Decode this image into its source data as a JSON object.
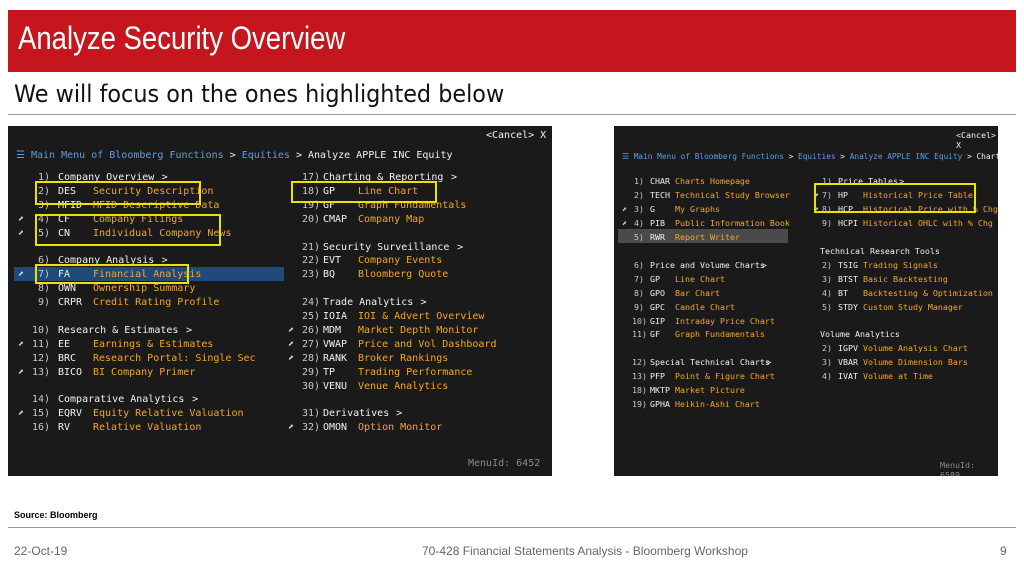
{
  "slide": {
    "title": "Analyze Security Overview",
    "subtitle": "We will focus on the ones highlighted below",
    "source": "Source: Bloomberg",
    "footer_date": "22-Oct-19",
    "footer_course": "70-428 Financial Statements Analysis - Bloomberg Workshop",
    "page_number": "9"
  },
  "colors": {
    "title_bar": "#c4161c",
    "terminal_bg": "#1a1a1a",
    "terminal_link": "#5a9fe6",
    "terminal_desc": "#f5a623",
    "highlight": "#f0e000"
  },
  "terminal1": {
    "cancel": "<Cancel> X",
    "breadcrumb": [
      {
        "text": "Main Menu of Bloomberg Functions",
        "kind": "link"
      },
      {
        "text": ">",
        "kind": "sep"
      },
      {
        "text": "Equities",
        "kind": "link"
      },
      {
        "text": ">",
        "kind": "sep"
      },
      {
        "text": "Analyze APPLE INC Equity",
        "kind": "current"
      }
    ],
    "menu_id": "MenuId: 6452",
    "left_column": [
      {
        "num": "1)",
        "header": "Company Overview"
      },
      {
        "num": "2)",
        "code": "DES",
        "desc": "Security Description"
      },
      {
        "num": "3)",
        "code": "MFID",
        "desc": "MFID Descriptive Data"
      },
      {
        "arrow": true,
        "num": "4)",
        "code": "CF",
        "desc": "Company Filings"
      },
      {
        "arrow": true,
        "num": "5)",
        "code": "CN",
        "desc": "Individual Company News"
      },
      {
        "blank": true
      },
      {
        "num": "6)",
        "header": "Company Analysis"
      },
      {
        "arrow": true,
        "num": "7)",
        "code": "FA",
        "desc": "Financial Analysis",
        "selected": true
      },
      {
        "num": "8)",
        "code": "OWN",
        "desc": "Ownership Summary"
      },
      {
        "num": "9)",
        "code": "CRPR",
        "desc": "Credit Rating Profile"
      },
      {
        "blank": true
      },
      {
        "num": "10)",
        "header": "Research & Estimates"
      },
      {
        "arrow": true,
        "num": "11)",
        "code": "EE",
        "desc": "Earnings & Estimates"
      },
      {
        "num": "12)",
        "code": "BRC",
        "desc": "Research Portal: Single Sec"
      },
      {
        "arrow": true,
        "num": "13)",
        "code": "BICO",
        "desc": "BI Company Primer"
      },
      {
        "blank": true
      },
      {
        "num": "14)",
        "header": "Comparative Analytics"
      },
      {
        "arrow": true,
        "num": "15)",
        "code": "EQRV",
        "desc": "Equity Relative Valuation"
      },
      {
        "num": "16)",
        "code": "RV",
        "desc": "Relative Valuation"
      }
    ],
    "right_column": [
      {
        "num": "17)",
        "header": "Charting & Reporting"
      },
      {
        "num": "18)",
        "code": "GP",
        "desc": "Line Chart"
      },
      {
        "num": "19)",
        "code": "GF",
        "desc": "Graph Fundamentals"
      },
      {
        "num": "20)",
        "code": "CMAP",
        "desc": "Company Map"
      },
      {
        "blank": true
      },
      {
        "num": "21)",
        "header": "Security Surveillance"
      },
      {
        "num": "22)",
        "code": "EVT",
        "desc": "Company Events"
      },
      {
        "num": "23)",
        "code": "BQ",
        "desc": "Bloomberg Quote"
      },
      {
        "blank": true
      },
      {
        "num": "24)",
        "header": "Trade Analytics"
      },
      {
        "num": "25)",
        "code": "IOIA",
        "desc": "IOI & Advert Overview"
      },
      {
        "arrow": true,
        "num": "26)",
        "code": "MDM",
        "desc": "Market Depth Monitor"
      },
      {
        "arrow": true,
        "num": "27)",
        "code": "VWAP",
        "desc": "Price and Vol Dashboard"
      },
      {
        "arrow": true,
        "num": "28)",
        "code": "RANK",
        "desc": "Broker Rankings"
      },
      {
        "num": "29)",
        "code": "TP",
        "desc": "Trading Performance"
      },
      {
        "num": "30)",
        "code": "VENU",
        "desc": "Venue Analytics"
      },
      {
        "blank": true
      },
      {
        "num": "31)",
        "header": "Derivatives"
      },
      {
        "arrow": true,
        "num": "32)",
        "code": "OMON",
        "desc": "Option Monitor"
      }
    ]
  },
  "terminal2": {
    "cancel": "<Cancel> X",
    "breadcrumb": [
      {
        "text": "Main Menu of Bloomberg Functions",
        "kind": "link"
      },
      {
        "text": ">",
        "kind": "sep"
      },
      {
        "text": "Equities",
        "kind": "link"
      },
      {
        "text": ">",
        "kind": "sep"
      },
      {
        "text": "Analyze APPLE INC Equity",
        "kind": "link"
      },
      {
        "text": ">",
        "kind": "sep"
      },
      {
        "text": "Charting & Reporting",
        "kind": "current"
      }
    ],
    "menu_id": "MenuId: 6589",
    "left_column": [
      {
        "num": "1)",
        "code": "CHAR",
        "desc": "Charts Homepage"
      },
      {
        "num": "2)",
        "code": "TECH",
        "desc": "Technical Study Browser"
      },
      {
        "arrow": true,
        "num": "3)",
        "code": "G",
        "desc": "My Graphs"
      },
      {
        "arrow": true,
        "num": "4)",
        "code": "PIB",
        "desc": "Public Information Book"
      },
      {
        "num": "5)",
        "code": "RWR",
        "desc": "Report Writer",
        "selected": true
      },
      {
        "blank": true
      },
      {
        "num": "6)",
        "plain": "Price and Volume Charts",
        "caret": ">"
      },
      {
        "num": "7)",
        "code": "GP",
        "desc": "Line Chart"
      },
      {
        "num": "8)",
        "code": "GPO",
        "desc": "Bar Chart"
      },
      {
        "num": "9)",
        "code": "GPC",
        "desc": "Candle Chart"
      },
      {
        "num": "10)",
        "code": "GIP",
        "desc": "Intraday Price Chart"
      },
      {
        "num": "11)",
        "code": "GF",
        "desc": "Graph Fundamentals"
      },
      {
        "blank": true
      },
      {
        "num": "12)",
        "plain": "Special Technical Charts",
        "caret": ">"
      },
      {
        "num": "13)",
        "code": "PFP",
        "desc": "Point & Figure Chart"
      },
      {
        "num": "18)",
        "code": "MKTP",
        "desc": "Market Picture"
      },
      {
        "num": "19)",
        "code": "GPHA",
        "desc": "Heikin-Ashi Chart"
      }
    ],
    "right_column": [
      {
        "num": "1)",
        "header": "Price Tables"
      },
      {
        "arrow": true,
        "num": "7)",
        "code": "HP",
        "desc": "Historical Price Table"
      },
      {
        "arrow": true,
        "num": "8)",
        "code": "HCP",
        "desc": "Historical Price with % Chg"
      },
      {
        "num": "9)",
        "code": "HCPI",
        "desc": "Historical OHLC with % Chg"
      },
      {
        "blank": true
      },
      {
        "plain": "Technical Research Tools"
      },
      {
        "num": "2)",
        "code": "TSIG",
        "desc": "Trading Signals"
      },
      {
        "num": "3)",
        "code": "BTST",
        "desc": "Basic Backtesting"
      },
      {
        "num": "4)",
        "code": "BT",
        "desc": "Backtesting & Optimization"
      },
      {
        "num": "5)",
        "code": "STDY",
        "desc": "Custom Study Manager"
      },
      {
        "blank": true
      },
      {
        "plain": "Volume Analytics"
      },
      {
        "num": "2)",
        "code": "IGPV",
        "desc": "Volume Analysis Chart"
      },
      {
        "num": "3)",
        "code": "VBAR",
        "desc": "Volume Dimension Bars"
      },
      {
        "num": "4)",
        "code": "IVAT",
        "desc": "Volume at Time"
      }
    ]
  }
}
